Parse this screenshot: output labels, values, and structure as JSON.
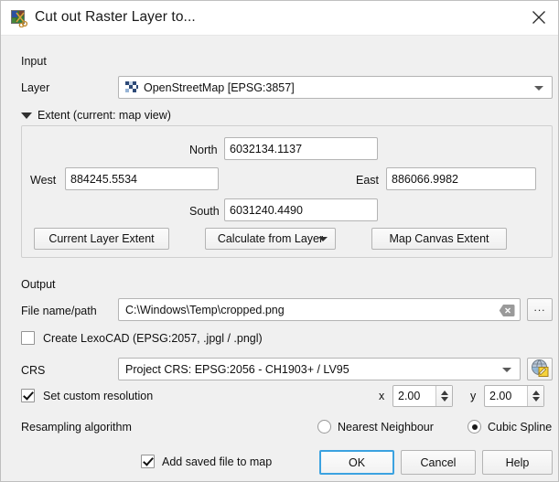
{
  "window": {
    "title": "Cut out Raster Layer to...",
    "icon": "raster-cut-icon",
    "close_icon": "close-icon",
    "accent": "#3ba2e0",
    "background": "#f0f0f0"
  },
  "input": {
    "section_label": "Input",
    "layer": {
      "label": "Layer",
      "icon": "raster-layer-icon",
      "value": "OpenStreetMap [EPSG:3857]"
    }
  },
  "extent": {
    "header": "Extent (current: map view)",
    "collapse_icon": "triangle-down-icon",
    "north": {
      "label": "North",
      "value": "6032134.1137"
    },
    "west": {
      "label": "West",
      "value": "884245.5534"
    },
    "east": {
      "label": "East",
      "value": "886066.9982"
    },
    "south": {
      "label": "South",
      "value": "6031240.4490"
    },
    "buttons": {
      "current_layer_extent": "Current Layer Extent",
      "calculate_from_layer": "Calculate from Layer",
      "map_canvas_extent": "Map Canvas Extent"
    }
  },
  "output": {
    "section_label": "Output",
    "file": {
      "label": "File name/path",
      "value": "C:\\Windows\\Temp\\cropped.png",
      "clear_icon": "clear-x-icon",
      "browse_label": "..."
    },
    "lexocad": {
      "label": "Create LexoCAD (EPSG:2057, .jpgl / .pngl)",
      "checked": false
    },
    "crs": {
      "label": "CRS",
      "value": "Project CRS: EPSG:2056 - CH1903+ / LV95",
      "select_icon": "globe-edit-icon"
    },
    "resolution": {
      "label": "Set custom resolution",
      "checked": true,
      "x_label": "x",
      "x_value": "2.00",
      "y_label": "y",
      "y_value": "2.00"
    },
    "resampling": {
      "label": "Resampling algorithm",
      "options": [
        {
          "label": "Nearest Neighbour",
          "selected": false
        },
        {
          "label": "Cubic Spline",
          "selected": true
        }
      ]
    }
  },
  "footer": {
    "add_to_map": {
      "label": "Add saved file to map",
      "checked": true
    },
    "ok": "OK",
    "cancel": "Cancel",
    "help": "Help"
  }
}
